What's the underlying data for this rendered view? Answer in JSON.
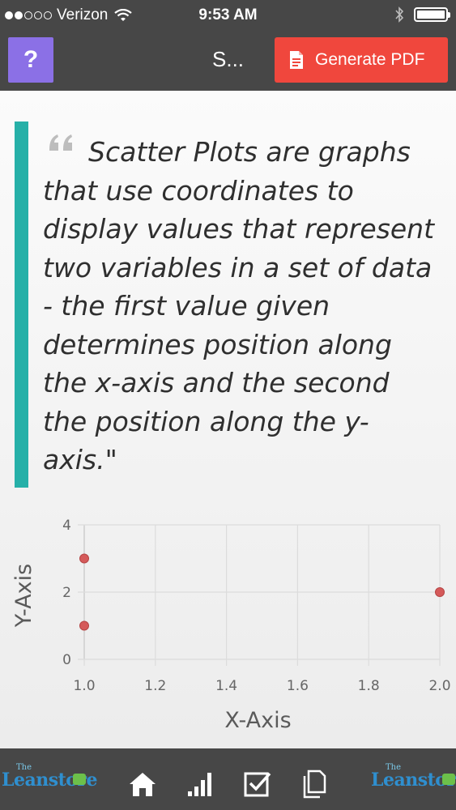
{
  "status_bar": {
    "carrier": "Verizon",
    "time": "9:53 AM"
  },
  "nav": {
    "help_label": "?",
    "title": "S...",
    "generate_pdf_label": "Generate PDF"
  },
  "quote": {
    "text": "Scatter Plots are graphs that use coordinates to display values that represent two variables in a set of data - the first value given determines position along the x-axis and the second the position along the y-axis.\""
  },
  "chart_data": {
    "type": "scatter",
    "title": "",
    "xlabel": "X-Axis",
    "ylabel": "Y-Axis",
    "xlim": [
      1.0,
      2.0
    ],
    "ylim": [
      0,
      4
    ],
    "x_ticks": [
      "1.0",
      "1.2",
      "1.4",
      "1.6",
      "1.8",
      "2.0"
    ],
    "y_ticks": [
      "0",
      "2",
      "4"
    ],
    "grid": true,
    "point_color": "#d55a5a",
    "series": [
      {
        "points": [
          {
            "x": 1.0,
            "y": 3
          },
          {
            "x": 1.0,
            "y": 1
          },
          {
            "x": 2.0,
            "y": 2
          }
        ]
      }
    ]
  },
  "logos": {
    "left": {
      "small": "The",
      "name": "Leanstore"
    },
    "right": {
      "small": "The",
      "name": "Leanstore"
    }
  },
  "tabs": [
    {
      "icon": "home-icon"
    },
    {
      "icon": "bar-chart-icon"
    },
    {
      "icon": "checkbox-icon"
    },
    {
      "icon": "documents-icon"
    }
  ],
  "colors": {
    "bars": "#474747",
    "help_button": "#8b70e6",
    "pdf_button": "#f0473d",
    "quote_accent": "#26b0a8"
  }
}
